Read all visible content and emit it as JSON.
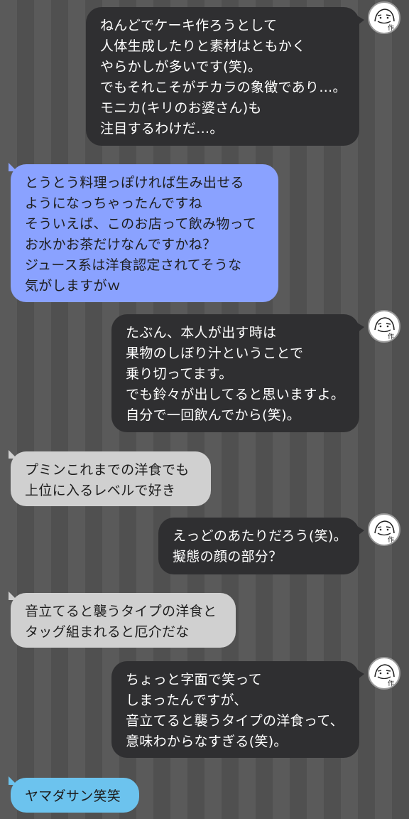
{
  "messages": [
    {
      "lines": [
        "ねんどでケーキ作ろうとして",
        "人体生成したりと素材はともかく",
        "やらかしが多いです(笑)。",
        "でもそれこそがチカラの象徴であり…。",
        "モニカ(キリのお婆さん)も",
        "注目するわけだ…。"
      ]
    },
    {
      "lines": [
        "とうとう料理っぽければ生み出せる",
        "ようになっちゃったんですね",
        "そういえば、このお店って飲み物って",
        "お水かお茶だけなんですかね？",
        "ジュース系は洋食認定されてそうな",
        "気がしますがｗ"
      ]
    },
    {
      "lines": [
        "たぶん、本人が出す時は",
        "果物のしぼり汁ということで",
        "乗り切ってます。",
        "でも鈴々が出してると思いますよ。",
        "自分で一回飲んでから(笑)。"
      ]
    },
    {
      "lines": [
        "プミンこれまでの洋食でも",
        "上位に入るレベルで好き"
      ]
    },
    {
      "lines": [
        "えっどのあたりだろう(笑)。",
        "擬態の顔の部分？"
      ]
    },
    {
      "lines": [
        "音立てると襲うタイプの洋食と",
        "タッグ組まれると厄介だな"
      ]
    },
    {
      "lines": [
        "ちょっと字面で笑って",
        "しまったんですが、",
        "音立てると襲うタイプの洋食って、",
        "意味わからなすぎる(笑)。"
      ]
    },
    {
      "lines": [
        "ヤマダサン笑笑"
      ]
    }
  ],
  "avatar": {
    "label": "作",
    "icon": "author-face-icon"
  },
  "colors": {
    "author_bubble": "#2f2f31",
    "reader_blue": "#8aa2ff",
    "reader_gray": "#d0d0d0",
    "reader_cyan": "#6cc3ee",
    "stripe_light": "#5a5a5a",
    "stripe_dark": "#505050"
  }
}
